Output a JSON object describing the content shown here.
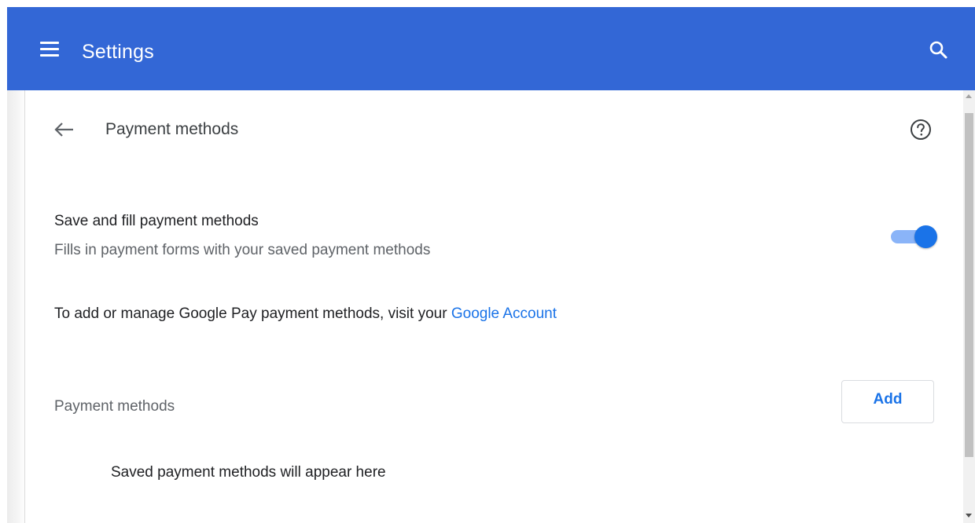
{
  "header": {
    "title": "Settings",
    "menu_icon": "hamburger-menu-icon",
    "search_icon": "search-icon",
    "bg_color": "#3367d6"
  },
  "subpage": {
    "back_icon": "arrow-back-icon",
    "title": "Payment methods",
    "help_icon": "help-circle-icon"
  },
  "autofill_setting": {
    "label": "Save and fill payment methods",
    "sublabel": "Fills in payment forms with your saved payment methods",
    "enabled": true
  },
  "google_pay": {
    "text": "To add or manage Google Pay payment methods, visit your",
    "link_text": "Google Account"
  },
  "payment_methods_section": {
    "heading": "Payment methods",
    "add_button_label": "Add",
    "empty_message": "Saved payment methods will appear here"
  },
  "colors": {
    "accent": "#1a73e8",
    "toggle_track": "#8ab4f8"
  }
}
